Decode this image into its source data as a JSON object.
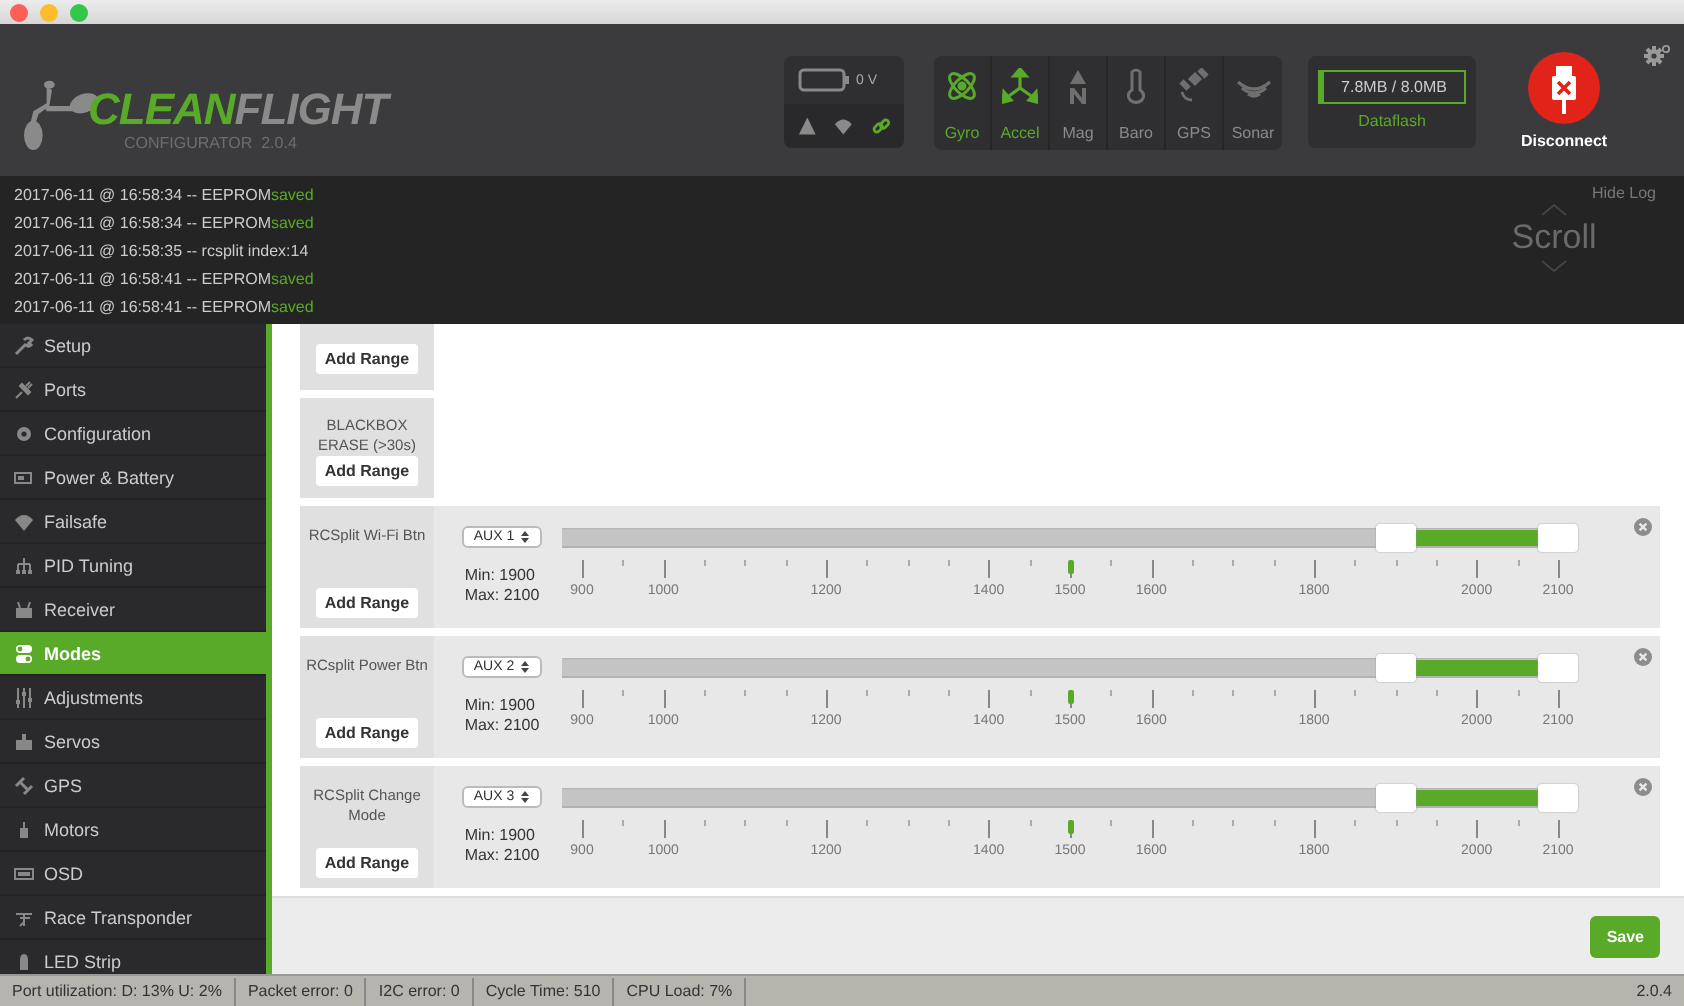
{
  "header": {
    "logo": {
      "accent": "CLEAN",
      "word": "FLIGHT",
      "subtitle": "CONFIGURATOR  2.0.4"
    },
    "battery": {
      "voltage": "0 V"
    },
    "status_icons": [
      {
        "kind": "warning",
        "on": false
      },
      {
        "kind": "parachute",
        "on": false
      },
      {
        "kind": "link",
        "on": true
      }
    ],
    "sensors": [
      {
        "label": "Gyro",
        "kind": "gyro",
        "on": true
      },
      {
        "label": "Accel",
        "kind": "accel",
        "on": true
      },
      {
        "label": "Mag",
        "kind": "mag",
        "on": false
      },
      {
        "label": "Baro",
        "kind": "baro",
        "on": false
      },
      {
        "label": "GPS",
        "kind": "gps",
        "on": false
      },
      {
        "label": "Sonar",
        "kind": "sonar",
        "on": false
      }
    ],
    "dataflash": {
      "usage": "7.8MB / 8.0MB",
      "label": "Dataflash"
    },
    "connect_button": {
      "label": "Disconnect"
    }
  },
  "log": {
    "entries": [
      {
        "text": "2017-06-11 @ 16:58:34 -- EEPROM",
        "status": "saved"
      },
      {
        "text": "2017-06-11 @ 16:58:34 -- EEPROM",
        "status": "saved"
      },
      {
        "text": "2017-06-11 @ 16:58:35 -- rcsplit index:14"
      },
      {
        "text": "2017-06-11 @ 16:58:41 -- EEPROM",
        "status": "saved"
      },
      {
        "text": "2017-06-11 @ 16:58:41 -- EEPROM",
        "status": "saved"
      }
    ],
    "toggle": "Hide Log",
    "scroll_hint": "Scroll"
  },
  "sidebar": {
    "items": [
      {
        "label": "Setup",
        "selected": false
      },
      {
        "label": "Ports",
        "selected": false
      },
      {
        "label": "Configuration",
        "selected": false
      },
      {
        "label": "Power & Battery",
        "selected": false
      },
      {
        "label": "Failsafe",
        "selected": false
      },
      {
        "label": "PID Tuning",
        "selected": false
      },
      {
        "label": "Receiver",
        "selected": false
      },
      {
        "label": "Modes",
        "selected": true
      },
      {
        "label": "Adjustments",
        "selected": false
      },
      {
        "label": "Servos",
        "selected": false
      },
      {
        "label": "GPS",
        "selected": false
      },
      {
        "label": "Motors",
        "selected": false
      },
      {
        "label": "OSD",
        "selected": false
      },
      {
        "label": "Race Transponder",
        "selected": false
      },
      {
        "label": "LED Strip",
        "selected": false
      }
    ]
  },
  "modes": [
    {
      "add_button": "Add Range"
    },
    {
      "name": "BLACKBOX ERASE (>30s)",
      "add_button": "Add Range"
    },
    {
      "name": "RCSplit Wi-Fi Btn",
      "add_button": "Add Range",
      "channel": "AUX 1",
      "min": "Min: 1900",
      "max": "Max: 2100",
      "level": 0.5,
      "scale": [
        "900",
        "1000",
        "1200",
        "1400",
        "1500",
        "1600",
        "1800",
        "2000",
        "2100"
      ]
    },
    {
      "name": "RCsplit Power Btn",
      "add_button": "Add Range",
      "channel": "AUX 2",
      "min": "Min: 1900",
      "max": "Max: 2100",
      "level": 0.5,
      "scale": [
        "900",
        "1000",
        "1200",
        "1400",
        "1500",
        "1600",
        "1800",
        "2000",
        "2100"
      ]
    },
    {
      "name": "RCSplit Change Mode",
      "add_button": "Add Range",
      "channel": "AUX 3",
      "min": "Min: 1900",
      "max": "Max: 2100",
      "level": 0.5,
      "scale": [
        "900",
        "1000",
        "1200",
        "1400",
        "1500",
        "1600",
        "1800",
        "2000",
        "2100"
      ]
    }
  ],
  "footer": {
    "save_button": "Save"
  },
  "status_bar": {
    "items": [
      "Port utilization: D: 13% U: 2%",
      "Packet error: 0",
      "I2C error: 0",
      "Cycle Time: 510",
      "CPU Load: 7%"
    ],
    "version": "2.0.4"
  }
}
